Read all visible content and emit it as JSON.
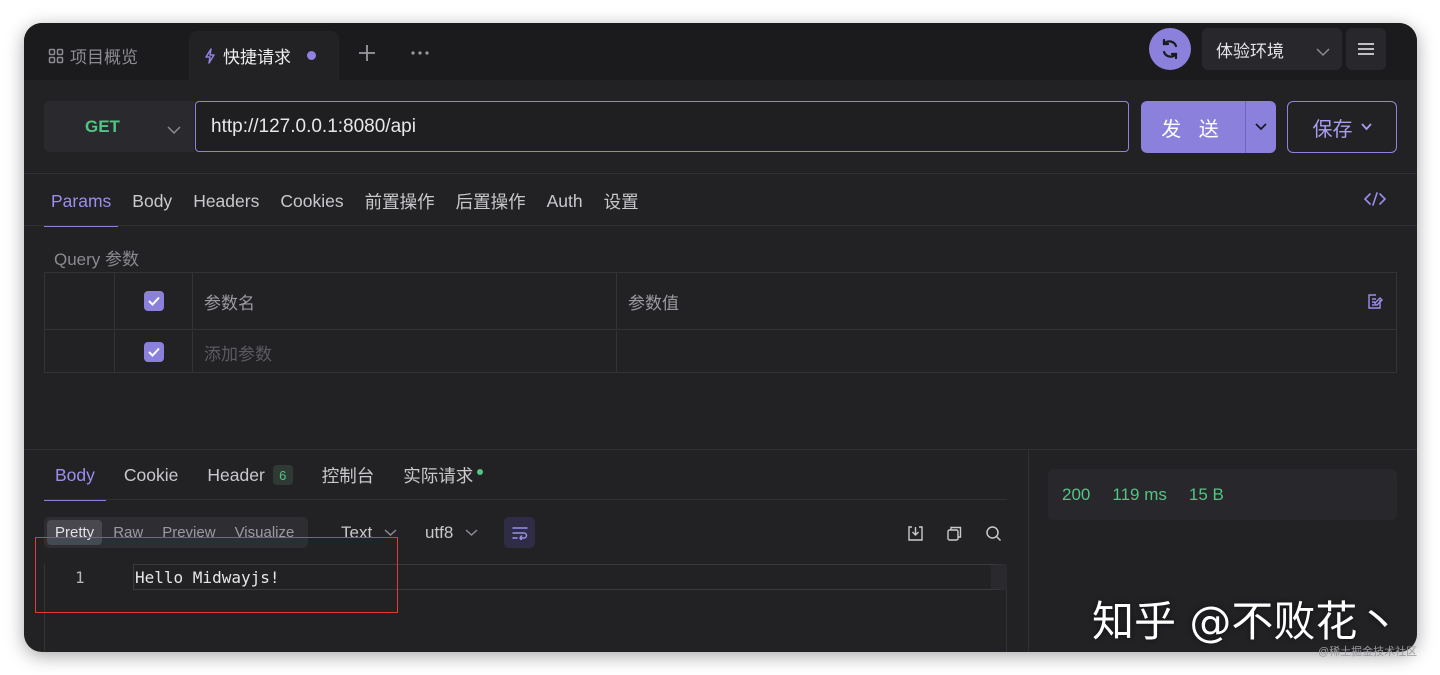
{
  "tabs": {
    "overview": "项目概览",
    "active": "快捷请求"
  },
  "environment": "体验环境",
  "request": {
    "method": "GET",
    "url": "http://127.0.0.1:8080/api",
    "send_label": "发 送",
    "save_label": "保存"
  },
  "request_tabs": [
    "Params",
    "Body",
    "Headers",
    "Cookies",
    "前置操作",
    "后置操作",
    "Auth",
    "设置"
  ],
  "query": {
    "section_title": "Query 参数",
    "col_name": "参数名",
    "col_value": "参数值",
    "add_placeholder": "添加参数"
  },
  "response_tabs": {
    "body": "Body",
    "cookie": "Cookie",
    "header": "Header",
    "header_count": "6",
    "console": "控制台",
    "actual": "实际请求"
  },
  "format_buttons": [
    "Pretty",
    "Raw",
    "Preview",
    "Visualize"
  ],
  "format_selected": "Pretty",
  "response_type": "Text",
  "encoding": "utf8",
  "editor": {
    "line_number": "1",
    "content": "Hello Midwayjs!"
  },
  "status": {
    "code": "200",
    "time": "119 ms",
    "size": "15 B"
  },
  "watermark": "知乎 @不败花丶",
  "credit": "@稀土掘金技术社区",
  "colors": {
    "accent": "#8b80dc",
    "success": "#52c483",
    "background": "#222225"
  }
}
